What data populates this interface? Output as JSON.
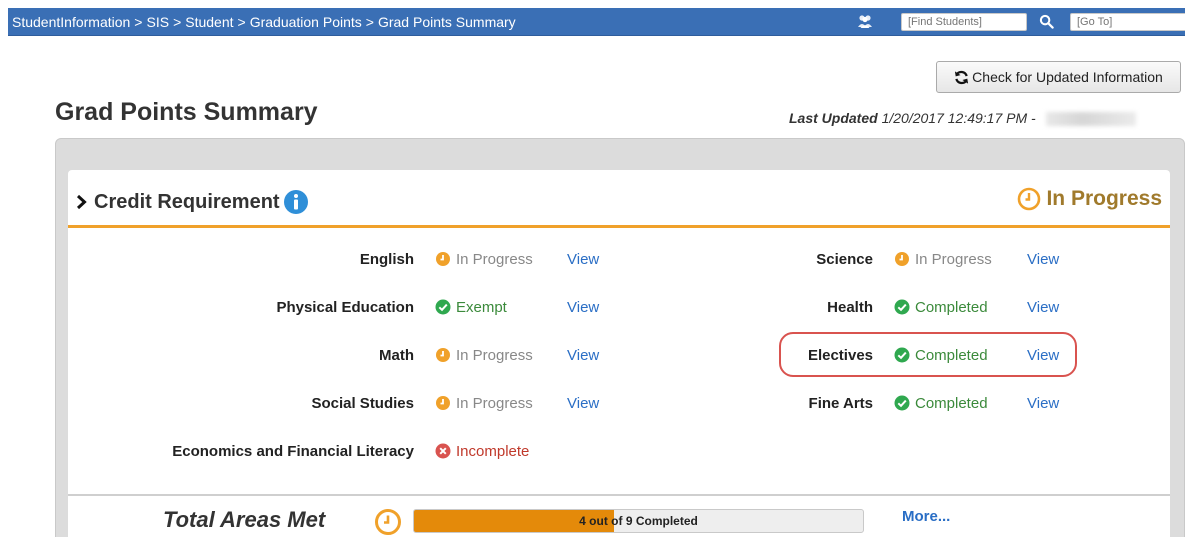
{
  "nav": {
    "breadcrumb": [
      "StudentInformation",
      "SIS",
      "Student",
      "Graduation Points",
      "Grad Points Summary"
    ],
    "separator": ">",
    "find_students_placeholder": "[Find Students]",
    "go_to_placeholder": "[Go To]"
  },
  "toolbar": {
    "check_label": "Check for Updated Information"
  },
  "page": {
    "title": "Grad Points Summary",
    "last_updated_label": "Last Updated",
    "last_updated_value": "1/20/2017 12:49:17 PM -"
  },
  "section": {
    "title": "Credit Requirement",
    "status": "In Progress"
  },
  "requirements_left": [
    {
      "label": "English",
      "status": "In Progress",
      "status_type": "in-progress",
      "view": "View"
    },
    {
      "label": "Physical Education",
      "status": "Exempt",
      "status_type": "complete",
      "view": "View"
    },
    {
      "label": "Math",
      "status": "In Progress",
      "status_type": "in-progress",
      "view": "View"
    },
    {
      "label": "Social Studies",
      "status": "In Progress",
      "status_type": "in-progress",
      "view": "View"
    },
    {
      "label": "Economics and Financial Literacy",
      "status": "Incomplete",
      "status_type": "incomplete",
      "view": ""
    }
  ],
  "requirements_right": [
    {
      "label": "Science",
      "status": "In Progress",
      "status_type": "in-progress",
      "view": "View"
    },
    {
      "label": "Health",
      "status": "Completed",
      "status_type": "complete",
      "view": "View"
    },
    {
      "label": "Electives",
      "status": "Completed",
      "status_type": "complete",
      "view": "View"
    },
    {
      "label": "Fine Arts",
      "status": "Completed",
      "status_type": "complete",
      "view": "View"
    }
  ],
  "totals": {
    "label": "Total Areas Met",
    "progress_text": "4 out of 9 Completed",
    "completed": 4,
    "total": 9,
    "more_label": "More..."
  },
  "colors": {
    "nav_bar": "#3a6fb5",
    "accent_orange": "#f0a12a",
    "progress_fill": "#e48a0a",
    "complete_green": "#2fa84f",
    "incomplete_red": "#d9534f",
    "link_blue": "#2a6ec5",
    "highlight_ring": "#d9534f"
  },
  "icons": {
    "in_progress": "clock-icon",
    "complete": "check-circle-icon",
    "incomplete": "x-circle-icon",
    "info": "info-icon",
    "refresh": "refresh-icon",
    "search": "search-icon",
    "users": "users-icon"
  }
}
